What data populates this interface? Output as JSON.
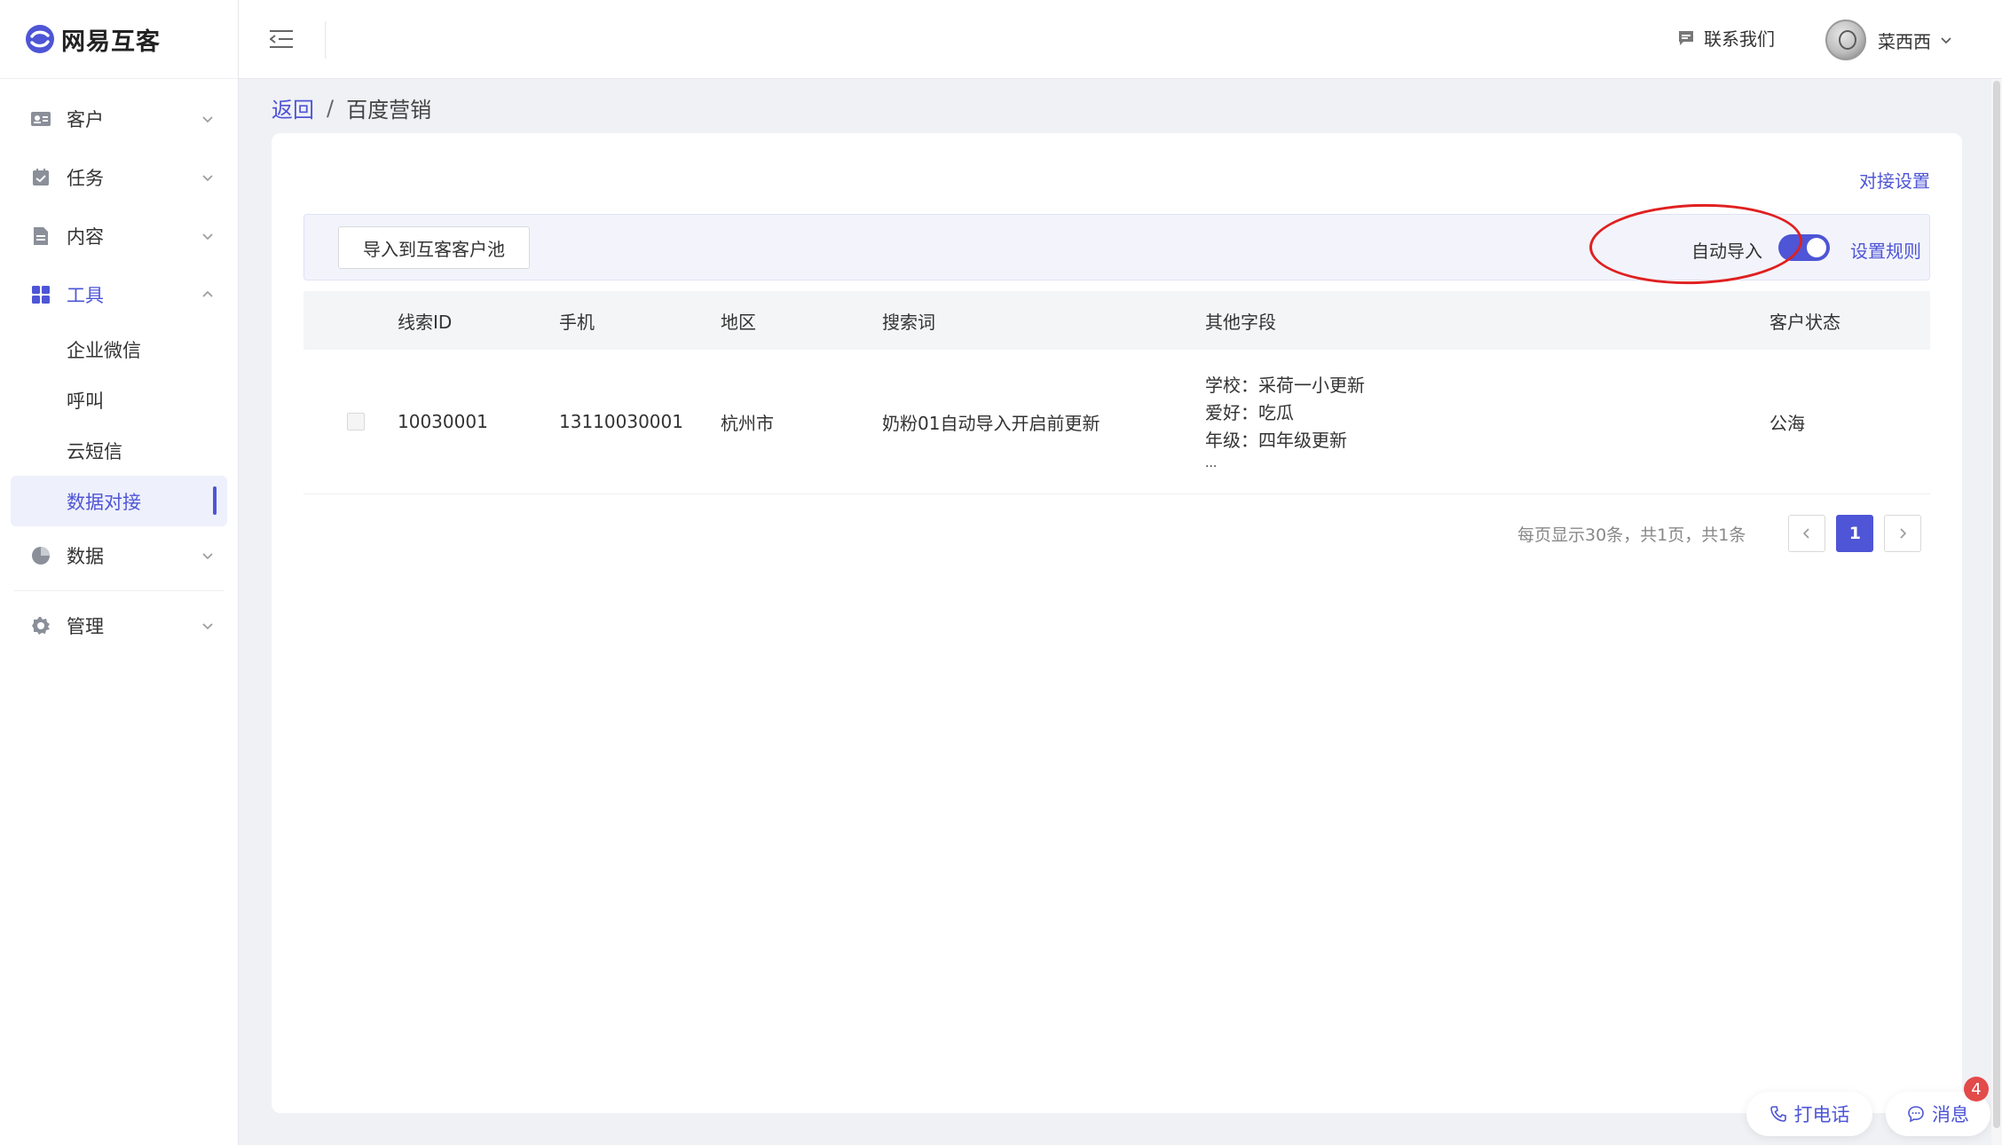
{
  "app": {
    "name": "网易互客"
  },
  "sidebar": {
    "items": [
      {
        "label": "客户",
        "icon": "contact-card-icon"
      },
      {
        "label": "任务",
        "icon": "calendar-check-icon"
      },
      {
        "label": "内容",
        "icon": "document-icon"
      },
      {
        "label": "工具",
        "icon": "grid-icon",
        "expanded": true
      },
      {
        "label": "数据",
        "icon": "pie-chart-icon"
      },
      {
        "label": "管理",
        "icon": "gear-icon"
      }
    ],
    "tools_sub": [
      {
        "label": "企业微信"
      },
      {
        "label": "呼叫"
      },
      {
        "label": "云短信"
      },
      {
        "label": "数据对接",
        "selected": true
      }
    ]
  },
  "topbar": {
    "contact_label": "联系我们",
    "user_name": "菜西西"
  },
  "breadcrumb": {
    "back": "返回",
    "separator": "/",
    "current": "百度营销"
  },
  "card": {
    "settings_link": "对接设置",
    "import_button": "导入到互客客户池",
    "auto_import_label": "自动导入",
    "auto_import_on": true,
    "rules_link": "设置规则"
  },
  "table": {
    "headers": [
      "线索ID",
      "手机",
      "地区",
      "搜索词",
      "其他字段",
      "客户状态"
    ],
    "rows": [
      {
        "id": "10030001",
        "phone": "13110030001",
        "region": "杭州市",
        "keyword": "奶粉01自动导入开启前更新",
        "other": [
          "学校：采荷一小更新",
          "爱好：吃瓜",
          "年级：四年级更新",
          "..."
        ],
        "status": "公海"
      }
    ]
  },
  "pagination": {
    "info": "每页显示30条，共1页，共1条",
    "current_page": "1"
  },
  "floating": {
    "call": "打电话",
    "messages": "消息",
    "badge": "4"
  },
  "colors": {
    "accent": "#4e55d6",
    "badge": "#e34a4a",
    "highlight": "#e02020"
  }
}
